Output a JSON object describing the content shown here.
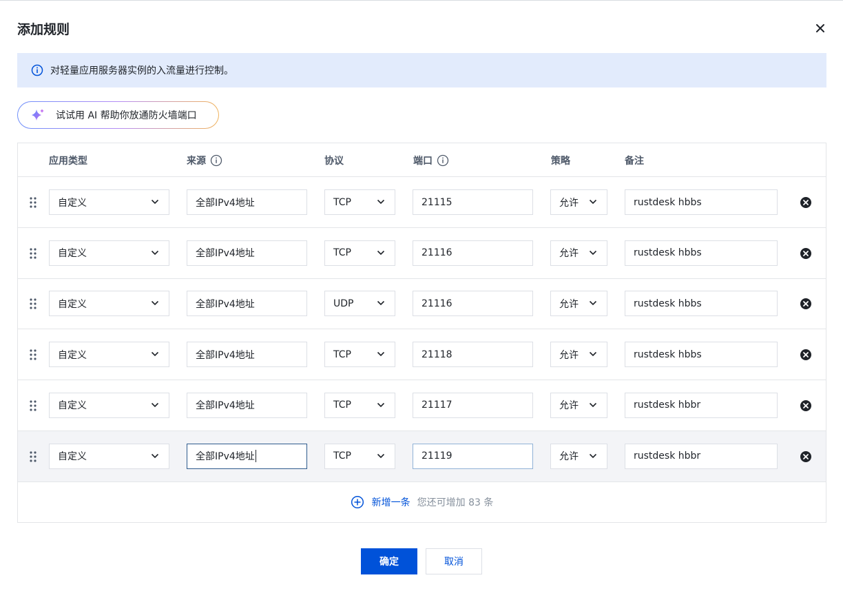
{
  "dialog": {
    "title": "添加规则",
    "close_icon": "close-icon"
  },
  "info": {
    "icon": "info-circle-icon",
    "text": "对轻量应用服务器实例的入流量进行控制。"
  },
  "ai_button": {
    "icon": "sparkle-icon",
    "label": "试试用 AI 帮助你放通防火墙端口"
  },
  "columns": {
    "app_type": "应用类型",
    "source": "来源",
    "protocol": "协议",
    "port": "端口",
    "policy": "策略",
    "remark": "备注"
  },
  "rules": [
    {
      "app_type": "自定义",
      "source": "全部IPv4地址",
      "protocol": "TCP",
      "port": "21115",
      "policy": "允许",
      "remark": "rustdesk hbbs"
    },
    {
      "app_type": "自定义",
      "source": "全部IPv4地址",
      "protocol": "TCP",
      "port": "21116",
      "policy": "允许",
      "remark": "rustdesk hbbs"
    },
    {
      "app_type": "自定义",
      "source": "全部IPv4地址",
      "protocol": "UDP",
      "port": "21116",
      "policy": "允许",
      "remark": "rustdesk hbbs"
    },
    {
      "app_type": "自定义",
      "source": "全部IPv4地址",
      "protocol": "TCP",
      "port": "21118",
      "policy": "允许",
      "remark": "rustdesk hbbs"
    },
    {
      "app_type": "自定义",
      "source": "全部IPv4地址",
      "protocol": "TCP",
      "port": "21117",
      "policy": "允许",
      "remark": "rustdesk hbbr"
    },
    {
      "app_type": "自定义",
      "source": "全部IPv4地址",
      "protocol": "TCP",
      "port": "21119",
      "policy": "允许",
      "remark": "rustdesk hbbr"
    }
  ],
  "add": {
    "label": "新增一条",
    "hint": "您还可增加 83 条"
  },
  "footer": {
    "ok_label": "确定",
    "cancel_label": "取消"
  },
  "colors": {
    "primary": "#0052d9",
    "info_bg": "#e2ebfc",
    "border": "#dcdfe5"
  }
}
